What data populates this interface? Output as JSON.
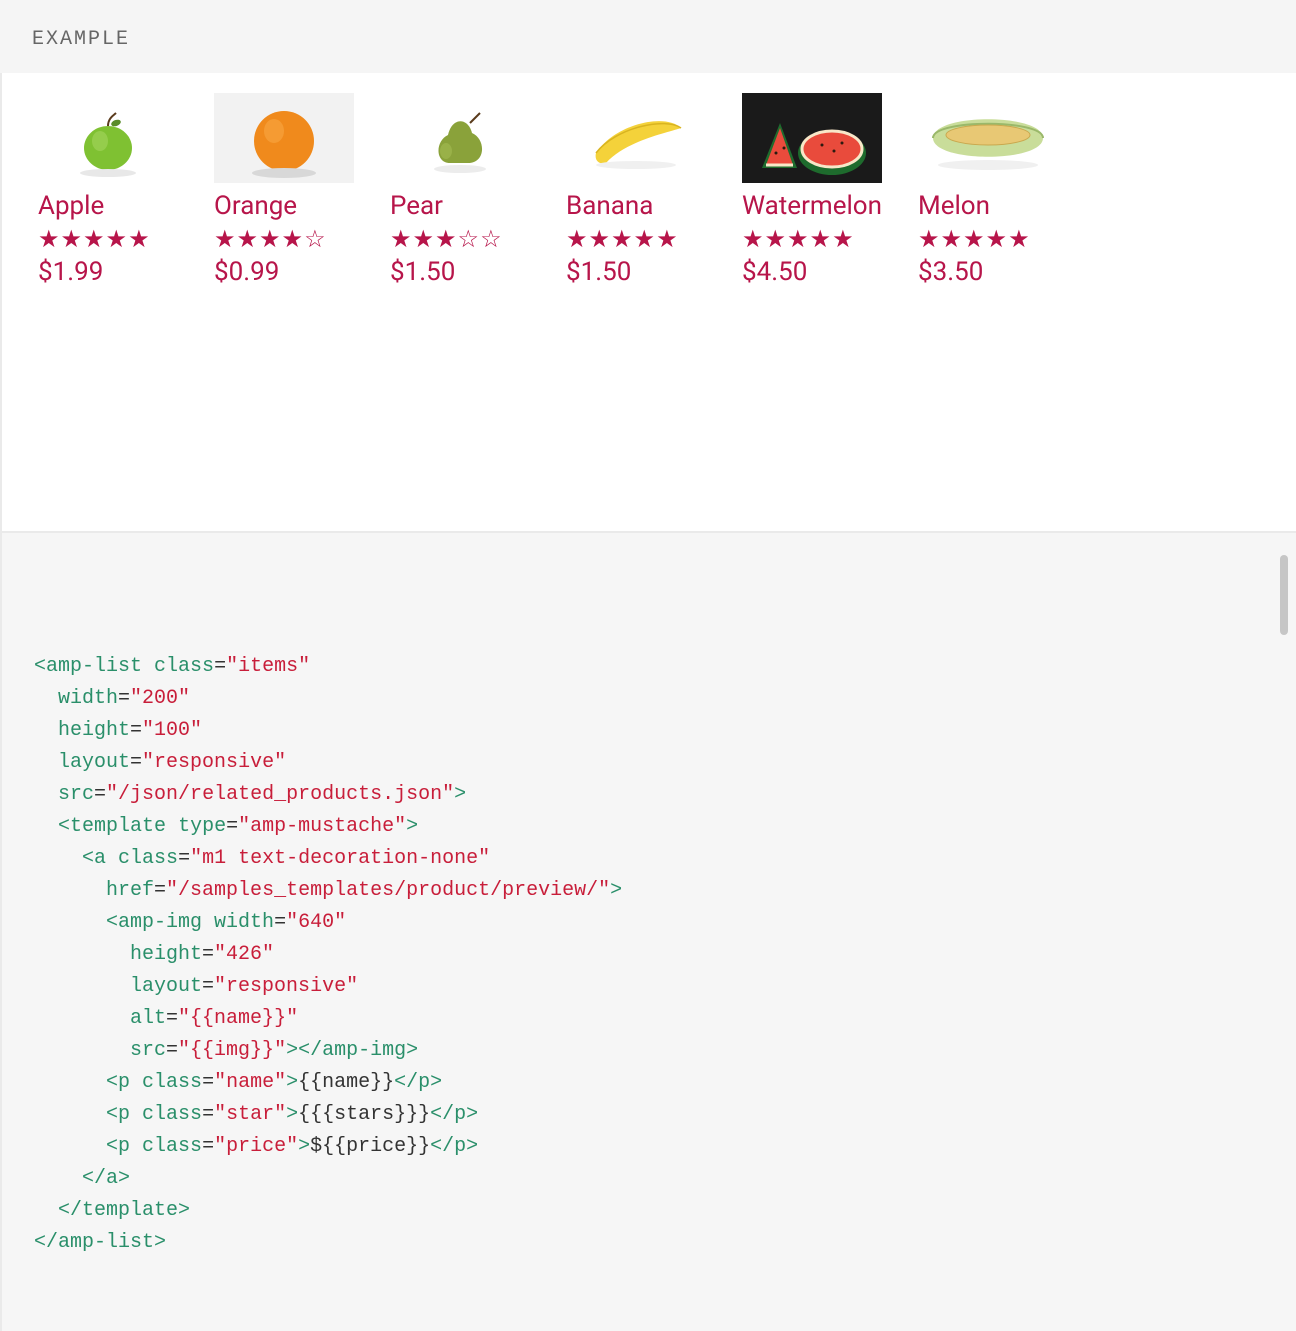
{
  "header": {
    "label": "EXAMPLE"
  },
  "products": [
    {
      "name": "Apple",
      "stars": "★★★★★",
      "price": "$1.99"
    },
    {
      "name": "Orange",
      "stars": "★★★★☆",
      "price": "$0.99"
    },
    {
      "name": "Pear",
      "stars": "★★★☆☆",
      "price": "$1.50"
    },
    {
      "name": "Banana",
      "stars": "★★★★★",
      "price": "$1.50"
    },
    {
      "name": "Watermelon",
      "stars": "★★★★★",
      "price": "$4.50"
    },
    {
      "name": "Melon",
      "stars": "★★★★★",
      "price": "$3.50"
    }
  ],
  "code": {
    "lines": [
      [
        [
          "tag",
          "<amp-list"
        ],
        [
          "text",
          " "
        ],
        [
          "attr",
          "class"
        ],
        [
          "punct",
          "="
        ],
        [
          "str",
          "\"items\""
        ]
      ],
      [
        [
          "text",
          "  "
        ],
        [
          "attr",
          "width"
        ],
        [
          "punct",
          "="
        ],
        [
          "str",
          "\"200\""
        ]
      ],
      [
        [
          "text",
          "  "
        ],
        [
          "attr",
          "height"
        ],
        [
          "punct",
          "="
        ],
        [
          "str",
          "\"100\""
        ]
      ],
      [
        [
          "text",
          "  "
        ],
        [
          "attr",
          "layout"
        ],
        [
          "punct",
          "="
        ],
        [
          "str",
          "\"responsive\""
        ]
      ],
      [
        [
          "text",
          "  "
        ],
        [
          "attr",
          "src"
        ],
        [
          "punct",
          "="
        ],
        [
          "str",
          "\"/json/related_products.json\""
        ],
        [
          "tag",
          ">"
        ]
      ],
      [
        [
          "text",
          "  "
        ],
        [
          "tag",
          "<template"
        ],
        [
          "text",
          " "
        ],
        [
          "attr",
          "type"
        ],
        [
          "punct",
          "="
        ],
        [
          "str",
          "\"amp-mustache\""
        ],
        [
          "tag",
          ">"
        ]
      ],
      [
        [
          "text",
          "    "
        ],
        [
          "tag",
          "<a"
        ],
        [
          "text",
          " "
        ],
        [
          "attr",
          "class"
        ],
        [
          "punct",
          "="
        ],
        [
          "str",
          "\"m1 text-decoration-none\""
        ]
      ],
      [
        [
          "text",
          "      "
        ],
        [
          "attr",
          "href"
        ],
        [
          "punct",
          "="
        ],
        [
          "str",
          "\"/samples_templates/product/preview/\""
        ],
        [
          "tag",
          ">"
        ]
      ],
      [
        [
          "text",
          "      "
        ],
        [
          "tag",
          "<amp-img"
        ],
        [
          "text",
          " "
        ],
        [
          "attr",
          "width"
        ],
        [
          "punct",
          "="
        ],
        [
          "str",
          "\"640\""
        ]
      ],
      [
        [
          "text",
          "        "
        ],
        [
          "attr",
          "height"
        ],
        [
          "punct",
          "="
        ],
        [
          "str",
          "\"426\""
        ]
      ],
      [
        [
          "text",
          "        "
        ],
        [
          "attr",
          "layout"
        ],
        [
          "punct",
          "="
        ],
        [
          "str",
          "\"responsive\""
        ]
      ],
      [
        [
          "text",
          "        "
        ],
        [
          "attr",
          "alt"
        ],
        [
          "punct",
          "="
        ],
        [
          "str",
          "\"{{name}}\""
        ]
      ],
      [
        [
          "text",
          "        "
        ],
        [
          "attr",
          "src"
        ],
        [
          "punct",
          "="
        ],
        [
          "str",
          "\"{{img}}\""
        ],
        [
          "tag",
          "></amp-img>"
        ]
      ],
      [
        [
          "text",
          "      "
        ],
        [
          "tag",
          "<p"
        ],
        [
          "text",
          " "
        ],
        [
          "attr",
          "class"
        ],
        [
          "punct",
          "="
        ],
        [
          "str",
          "\"name\""
        ],
        [
          "tag",
          ">"
        ],
        [
          "text",
          "{{name}}"
        ],
        [
          "tag",
          "</p>"
        ]
      ],
      [
        [
          "text",
          "      "
        ],
        [
          "tag",
          "<p"
        ],
        [
          "text",
          " "
        ],
        [
          "attr",
          "class"
        ],
        [
          "punct",
          "="
        ],
        [
          "str",
          "\"star\""
        ],
        [
          "tag",
          ">"
        ],
        [
          "text",
          "{{{stars}}}"
        ],
        [
          "tag",
          "</p>"
        ]
      ],
      [
        [
          "text",
          "      "
        ],
        [
          "tag",
          "<p"
        ],
        [
          "text",
          " "
        ],
        [
          "attr",
          "class"
        ],
        [
          "punct",
          "="
        ],
        [
          "str",
          "\"price\""
        ],
        [
          "tag",
          ">"
        ],
        [
          "text",
          "${{price}}"
        ],
        [
          "tag",
          "</p>"
        ]
      ],
      [
        [
          "text",
          "    "
        ],
        [
          "tag",
          "</a>"
        ]
      ],
      [
        [
          "text",
          "  "
        ],
        [
          "tag",
          "</template>"
        ]
      ],
      [
        [
          "tag",
          "</amp-list>"
        ]
      ]
    ]
  }
}
